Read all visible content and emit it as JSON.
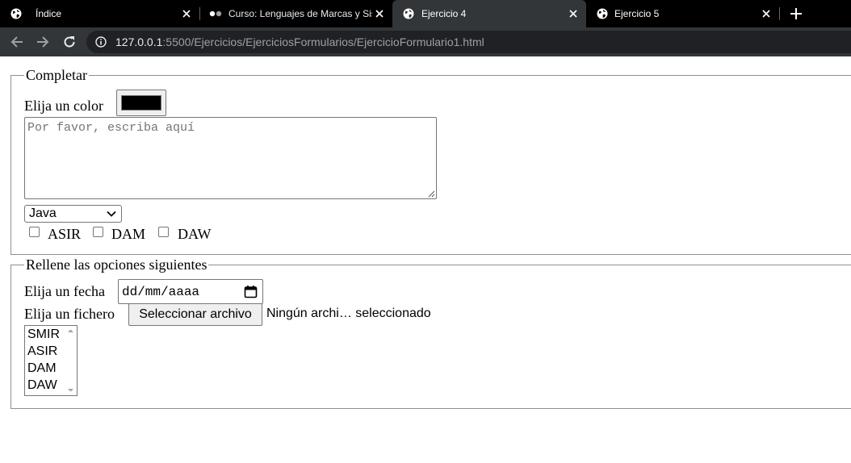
{
  "browser": {
    "tabs": [
      {
        "title": "Índice",
        "icon": "globe-icon",
        "active": false
      },
      {
        "title": "Curso: Lenguajes de Marcas y Sis",
        "icon": "loading-dots-icon",
        "active": false
      },
      {
        "title": "Ejercicio 4",
        "icon": "globe-icon",
        "active": true
      },
      {
        "title": "Ejercicio 5",
        "icon": "globe-icon",
        "active": false
      }
    ],
    "url_host": "127.0.0.1",
    "url_rest": ":5500/Ejercicios/EjerciciosFormularios/EjercicioFormulario1.html"
  },
  "form": {
    "fieldset1": {
      "legend": "Completar",
      "color_label": "Elija un color",
      "color_value": "#000000",
      "textarea_placeholder": "Por favor, escriba aquí",
      "select_value": "Java",
      "checkboxes": [
        {
          "label": "ASIR",
          "checked": false
        },
        {
          "label": "DAM",
          "checked": false
        },
        {
          "label": "DAW",
          "checked": false
        }
      ]
    },
    "fieldset2": {
      "legend": "Rellene las opciones siguientes",
      "date_label": "Elija un fecha",
      "date_placeholder": "dd/mm/aaaa",
      "file_label": "Elija un fichero",
      "file_button": "Seleccionar archivo",
      "file_status": "Ningún archi… seleccionado",
      "list_options": [
        "SMIR",
        "ASIR",
        "DAM",
        "DAW"
      ]
    }
  },
  "colors": {
    "tabbar_bg": "#000000",
    "toolbar_bg": "#323639",
    "omnibox_bg": "#202124"
  }
}
